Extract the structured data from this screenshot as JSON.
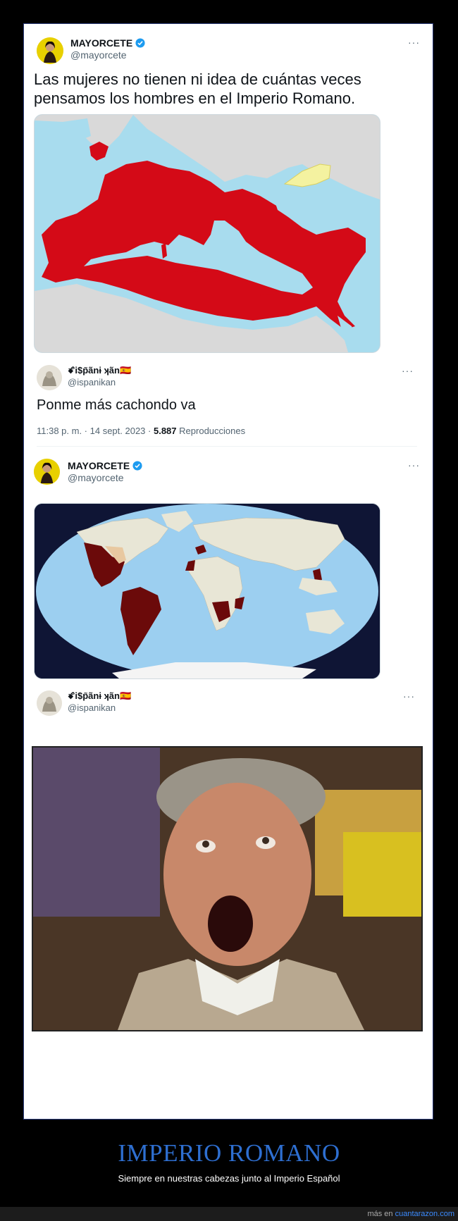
{
  "tweet1": {
    "display_name": "MAYORCETE",
    "handle": "@mayorcete",
    "text": "Las mujeres no tienen ni idea de cuántas veces pensamos los hombres en el Imperio Romano.",
    "more": "···"
  },
  "tweet2": {
    "display_name": "ꗄi$p̃ãnɨ ʞãn🇪🇸",
    "handle": "@ispanikan",
    "text": "Ponme más cachondo va",
    "time": "11:38 p. m. · 14 sept. 2023 ·",
    "views_count": "5.887",
    "views_label": "Reproducciones",
    "more": "···"
  },
  "tweet3": {
    "display_name": "MAYORCETE",
    "handle": "@mayorcete",
    "more": "···"
  },
  "tweet4": {
    "display_name": "ꗄi$p̃ãnɨ ʞãn🇪🇸",
    "handle": "@ispanikan",
    "more": "···"
  },
  "caption": {
    "title": "IMPERIO ROMANO",
    "subtitle": "Siempre en nuestras cabezas junto al Imperio Español"
  },
  "footer": {
    "prefix": "más en",
    "site": "cuantarazon.com"
  },
  "colors": {
    "accent": "#2e6fd1",
    "roman_red": "#d40a17",
    "spanish_maroon": "#6b0a0a",
    "sea": "#a8dcee",
    "verified": "#1d9bf0"
  }
}
